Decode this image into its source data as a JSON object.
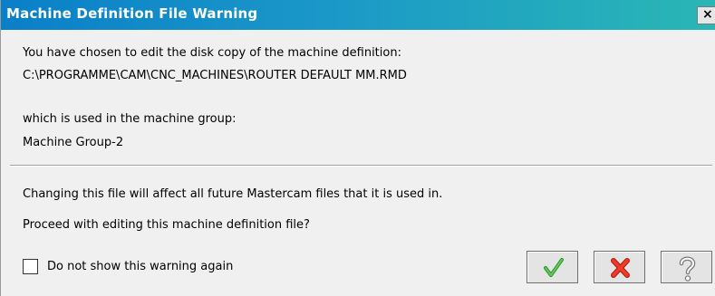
{
  "window": {
    "title": "Machine Definition File Warning",
    "close_glyph": "×"
  },
  "message": {
    "line1": "You have chosen to edit the disk copy of the machine definition:",
    "path": "C:\\PROGRAMME\\CAM\\CNC_MACHINES\\ROUTER DEFAULT MM.RMD",
    "line3": "which is used in the machine group:",
    "group": "Machine Group-2",
    "line5": "Changing this file will affect all future Mastercam files that it is used in.",
    "question": "Proceed with editing this machine definition file?"
  },
  "checkbox": {
    "label": "Do not show this warning again",
    "checked": false
  },
  "buttons": [
    {
      "id": "ok",
      "icon": "checkmark-icon",
      "color": "#3aa635"
    },
    {
      "id": "cancel",
      "icon": "x-icon",
      "color": "#e02a1c"
    },
    {
      "id": "help",
      "icon": "question-icon",
      "color": "#8a8a8a"
    }
  ],
  "colors": {
    "title_start": "#0a7fc8",
    "title_end": "#2ab7b5",
    "background": "#f0f0f0"
  }
}
